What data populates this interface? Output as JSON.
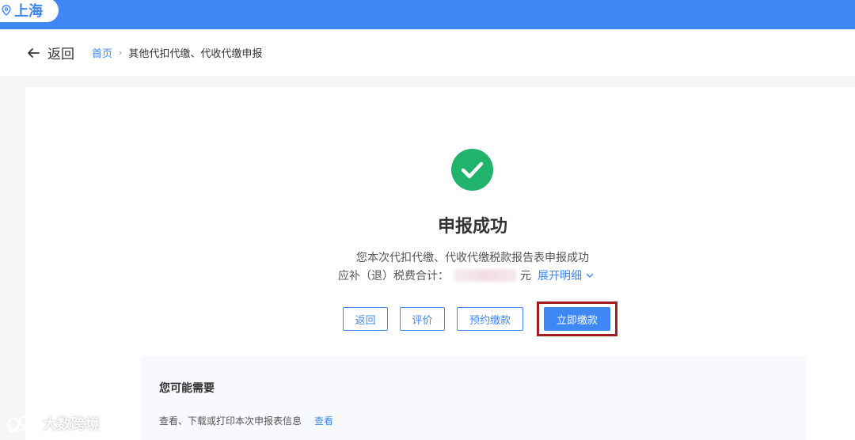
{
  "header": {
    "location": "上海",
    "brand_color": "#3f88f4"
  },
  "nav": {
    "back_label": "返回",
    "breadcrumb": {
      "home": "首页",
      "current": "其他代扣代缴、代收代缴申报"
    }
  },
  "result": {
    "title": "申报成功",
    "description": "您本次代扣代缴、代收代缴税款报告表申报成功",
    "amount_label": "应补（退）税费合计：",
    "amount_unit": "元",
    "detail_link": "展开明细",
    "success_color": "#1fb36b"
  },
  "actions": {
    "back": "返回",
    "evaluate": "评价",
    "reserve_pay": "预约缴款",
    "pay_now": "立即缴款",
    "highlight_color": "#a31d1d"
  },
  "maybe_need": {
    "title": "您可能需要",
    "items": [
      {
        "text": "查看、下载或打印本次申报表信息",
        "link": "查看"
      }
    ]
  },
  "watermark": {
    "text": "大数跨境"
  }
}
